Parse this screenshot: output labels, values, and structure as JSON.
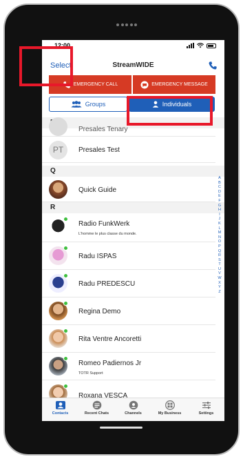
{
  "status": {
    "time": "12:00"
  },
  "nav": {
    "select": "Select",
    "title": "StreamWIDE"
  },
  "emergency": {
    "call": "EMERGENCY CALL",
    "message": "EMERGENCY MESSAGE"
  },
  "segments": {
    "groups": "Groups",
    "individuals": "Individuals"
  },
  "sections": {
    "p": "P",
    "q": "Q",
    "r": "R"
  },
  "contacts": [
    {
      "name": "Presales Tenary",
      "sub": "",
      "initials": ""
    },
    {
      "name": "Presales Test",
      "sub": "",
      "initials": "PT"
    },
    {
      "name": "Quick Guide",
      "sub": ""
    },
    {
      "name": "Radio FunkWerk",
      "sub": "L'homme le plus classe du monde."
    },
    {
      "name": "Radu ISPAS",
      "sub": ""
    },
    {
      "name": "Radu PREDESCU",
      "sub": ""
    },
    {
      "name": "Regina  Demo",
      "sub": ""
    },
    {
      "name": "Rita Ventre Ancoretti",
      "sub": ""
    },
    {
      "name": "Romeo Padiernos Jr",
      "sub": "TOTR Support"
    },
    {
      "name": "Roxana VESCA",
      "sub": ""
    }
  ],
  "index_letters": [
    "A",
    "B",
    "C",
    "D",
    "E",
    "F",
    "G",
    "H",
    "I",
    "J",
    "K",
    "L",
    "M",
    "N",
    "O",
    "P",
    "Q",
    "R",
    "S",
    "T",
    "U",
    "V",
    "W",
    "X",
    "Y",
    "Z"
  ],
  "tabs": [
    {
      "label": "Contacts",
      "icon": "contacts-icon"
    },
    {
      "label": "Recent Chats",
      "icon": "chat-icon"
    },
    {
      "label": "Channels",
      "icon": "channels-icon"
    },
    {
      "label": "My Business",
      "icon": "business-icon"
    },
    {
      "label": "Settings",
      "icon": "settings-icon"
    }
  ],
  "colors": {
    "accent": "#1f5fb8",
    "emergency": "#d63a24",
    "highlight": "#e8182a",
    "online": "#3fbf3f"
  }
}
